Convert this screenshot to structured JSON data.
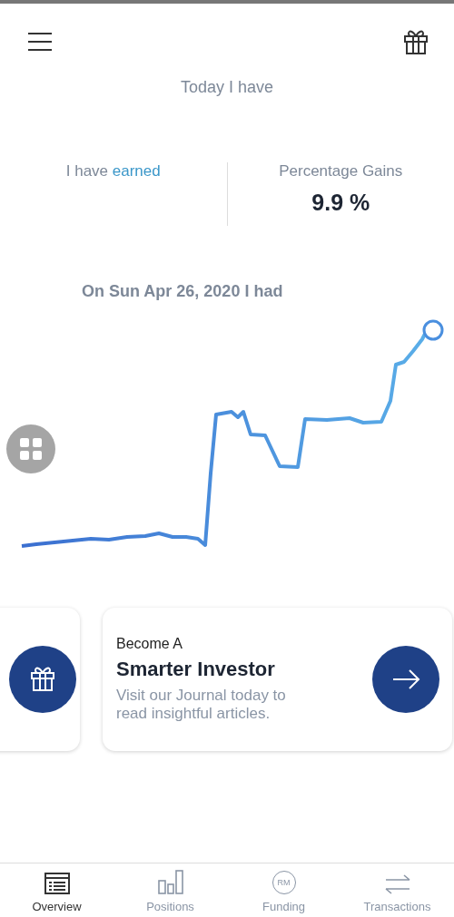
{
  "header": {
    "title": "Today I have"
  },
  "stats": [
    {
      "label": "I have **earned**"
    },
    {
      "label": "Percentage Gains",
      "value": "9.9 %"
    }
  ],
  "chart": {
    "title": "On Sun Apr 26, 2020 I had"
  },
  "cards": [
    {
      "kind": "gift"
    },
    {
      "kind": "promo",
      "eyebrow": "Become A",
      "title": "Smarter Investor",
      "body": "Visit our Journal today to read insightful articles."
    }
  ],
  "tabs": [
    {
      "label": "Overview",
      "kind": "list",
      "selected": true
    },
    {
      "label": "Positions",
      "kind": "bars",
      "selected": false
    },
    {
      "label": "Funding",
      "kind": "coin",
      "icon_text": "RM",
      "selected": false
    },
    {
      "label": "Transactions",
      "kind": "swap",
      "selected": false
    }
  ]
}
